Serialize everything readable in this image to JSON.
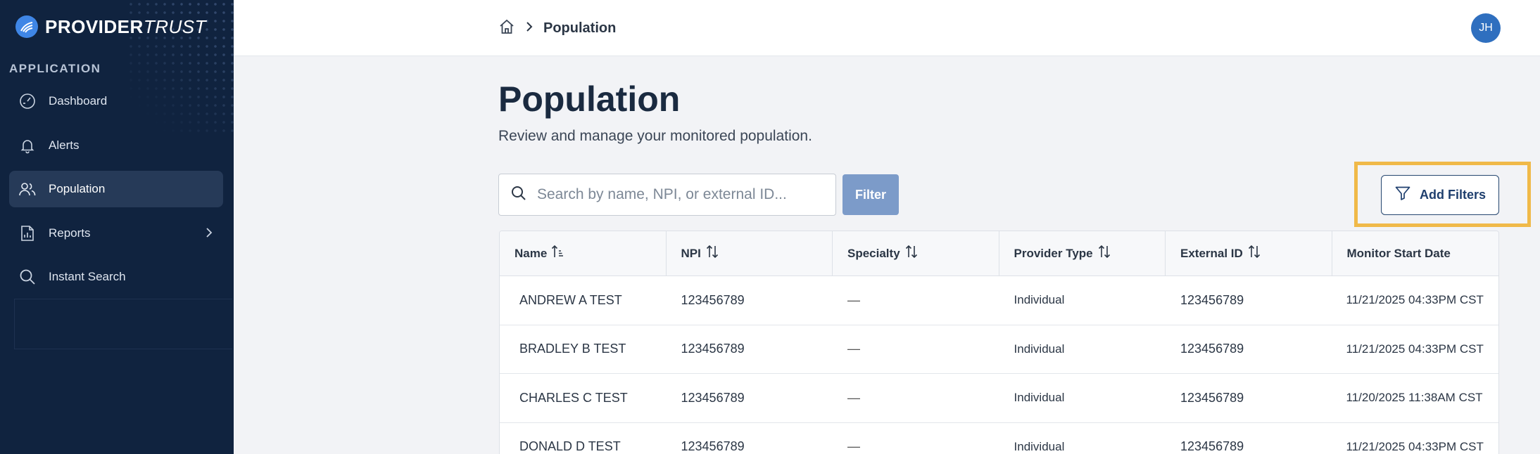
{
  "brand": {
    "bold": "PROVIDER",
    "italic": "TRUST"
  },
  "sidebar": {
    "section_label": "APPLICATION",
    "items": [
      {
        "label": "Dashboard",
        "icon": "dashboard-icon"
      },
      {
        "label": "Alerts",
        "icon": "bell-icon"
      },
      {
        "label": "Population",
        "icon": "users-icon",
        "active": true
      },
      {
        "label": "Reports",
        "icon": "report-icon",
        "has_submenu": true
      },
      {
        "label": "Instant Search",
        "icon": "search-icon"
      }
    ]
  },
  "header": {
    "breadcrumb_current": "Population",
    "avatar_initials": "JH"
  },
  "main": {
    "title": "Population",
    "subtitle": "Review and manage your monitored population.",
    "search_placeholder": "Search by name, NPI, or external ID...",
    "filter_label": "Filter",
    "add_filters_label": "Add Filters"
  },
  "table": {
    "columns": [
      "Name",
      "NPI",
      "Specialty",
      "Provider Type",
      "External ID",
      "Monitor Start Date"
    ],
    "rows": [
      [
        "ANDREW A TEST",
        "123456789",
        "—",
        "Individual",
        "123456789",
        "11/21/2025 04:33PM CST"
      ],
      [
        "BRADLEY B TEST",
        "123456789",
        "—",
        "Individual",
        "123456789",
        "11/21/2025 04:33PM CST"
      ],
      [
        "CHARLES C TEST",
        "123456789",
        "—",
        "Individual",
        "123456789",
        "11/20/2025 11:38AM CST"
      ],
      [
        "DONALD D TEST",
        "123456789",
        "—",
        "Individual",
        "123456789",
        "11/21/2025 04:33PM CST"
      ]
    ]
  },
  "colors": {
    "sidebar_bg": "#10233f",
    "accent": "#3f86e6",
    "highlight": "#f0b949",
    "filter_button": "#7c9bc9"
  }
}
